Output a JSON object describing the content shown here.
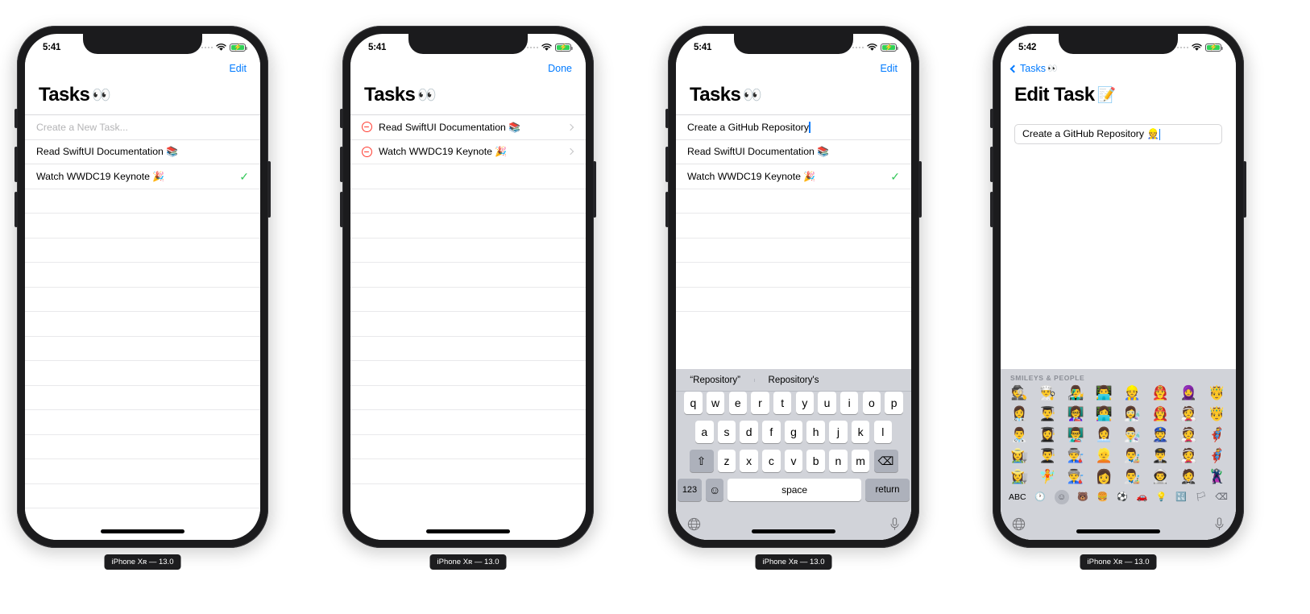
{
  "devices": [
    {
      "caption": "iPhone Xʀ — 13.0",
      "status": {
        "time": "5:41",
        "battery_charging": true
      },
      "screen": "task-list",
      "nav": {
        "action": "Edit"
      },
      "title": "Tasks",
      "title_emoji": "👀",
      "new_task_placeholder": "Create a New Task...",
      "tasks": [
        {
          "text": "Read SwiftUI Documentation",
          "emoji": "📚",
          "done": false
        },
        {
          "text": "Watch WWDC19 Keynote",
          "emoji": "🎉",
          "done": true
        }
      ],
      "empty_rows": 14
    },
    {
      "caption": "iPhone Xʀ — 13.0",
      "status": {
        "time": "5:41",
        "battery_charging": true
      },
      "screen": "task-list-editing",
      "nav": {
        "action": "Done"
      },
      "title": "Tasks",
      "title_emoji": "👀",
      "tasks": [
        {
          "text": "Read SwiftUI Documentation",
          "emoji": "📚",
          "done": false
        },
        {
          "text": "Watch WWDC19 Keynote",
          "emoji": "🎉",
          "done": false
        }
      ],
      "empty_rows": 14
    },
    {
      "caption": "iPhone Xʀ — 13.0",
      "status": {
        "time": "5:41",
        "battery_charging": true
      },
      "screen": "task-list-typing",
      "nav": {
        "action": "Edit"
      },
      "title": "Tasks",
      "title_emoji": "👀",
      "new_task_value": "Create a GitHub Repository",
      "tasks": [
        {
          "text": "Read SwiftUI Documentation",
          "emoji": "📚",
          "done": false
        },
        {
          "text": "Watch WWDC19 Keynote",
          "emoji": "🎉",
          "done": true
        }
      ],
      "empty_rows": 6,
      "keyboard": {
        "predictions": [
          "“Repository”",
          "Repository's"
        ],
        "row1": [
          "q",
          "w",
          "e",
          "r",
          "t",
          "y",
          "u",
          "i",
          "o",
          "p"
        ],
        "row2": [
          "a",
          "s",
          "d",
          "f",
          "g",
          "h",
          "j",
          "k",
          "l"
        ],
        "row3": [
          "z",
          "x",
          "c",
          "v",
          "b",
          "n",
          "m"
        ],
        "shift_label": "⇧",
        "backspace_label": "⌫",
        "numbers_label": "123",
        "emoji_label": "☺",
        "space_label": "space",
        "return_label": "return",
        "globe_label": "globe-icon",
        "mic_label": "mic-icon"
      }
    },
    {
      "caption": "iPhone Xʀ — 13.0",
      "status": {
        "time": "5:42",
        "battery_charging": true
      },
      "screen": "edit-task",
      "nav": {
        "back_label": "Tasks",
        "back_emoji": "👀"
      },
      "title": "Edit Task",
      "title_emoji": "📝",
      "field_value": "Create a GitHub Repository 👷",
      "emoji_keyboard": {
        "category": "SMILEYS & PEOPLE",
        "rows": [
          [
            "🕵️",
            "👨‍🍳",
            "👨‍🎤",
            "👨‍💻",
            "👷",
            "👨‍🚒",
            "🧕",
            "🤴"
          ],
          [
            "👩‍⚕️",
            "👨‍🎓",
            "👩‍🏫",
            "👩‍💻",
            "👩‍🔬",
            "👩‍🚒",
            "👰",
            "🤴"
          ],
          [
            "👨‍⚕️",
            "👩‍🎓",
            "👨‍🏫",
            "👩‍💼",
            "👨‍🔬",
            "👮",
            "👰",
            "🦸"
          ],
          [
            "👩‍🌾",
            "👨‍🎓",
            "👨‍🏭",
            "👱",
            "👨‍🎨",
            "👨‍✈️",
            "👰",
            "🦸"
          ],
          [
            "👩‍🌾",
            "🧚",
            "👨‍🏭",
            "👩",
            "👨‍🎨",
            "👨‍🚀",
            "🤵",
            "🦹"
          ]
        ],
        "tabs": [
          "ABC",
          "🕐",
          "☺",
          "🐻",
          "🍔",
          "⚽",
          "🚗",
          "💡",
          "🔣",
          "🏳"
        ],
        "selected_tab_index": 2,
        "globe_label": "globe-icon",
        "mic_label": "mic-icon"
      }
    }
  ]
}
